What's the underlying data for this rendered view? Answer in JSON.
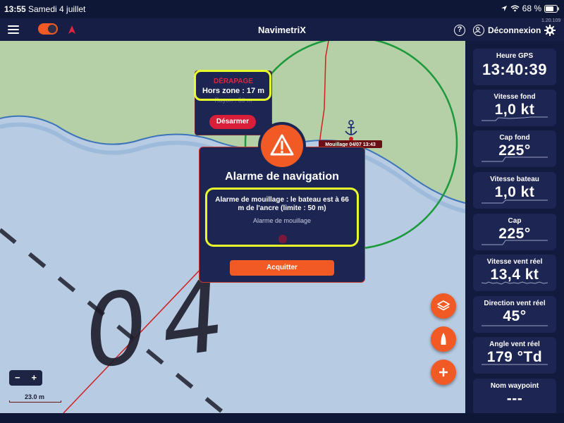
{
  "status_bar": {
    "time": "13:55",
    "date": "Samedi 4 juillet",
    "battery": "68 %"
  },
  "app": {
    "title": "NavimetriX",
    "logout_label": "Déconnexion",
    "version": "1.20.109",
    "help_label": "?"
  },
  "map": {
    "anchor_label": "Mouillage 04/07 13:43",
    "chart_number": "04",
    "zoom_out": "−",
    "zoom_in": "+",
    "scale_label": "23.0 m"
  },
  "drift_popup": {
    "title": "DÉRAPAGE",
    "line1": "Hors zone : 17 m",
    "line2": "Rayon : 50 m",
    "button": "Désarmer"
  },
  "alarm_modal": {
    "title": "Alarme de navigation",
    "message": "Alarme de mouillage : le bateau est à 66 m de l'ancre (limite : 50 m)",
    "subtitle": "Alarme de mouillage",
    "ack_button": "Acquitter"
  },
  "instruments": [
    {
      "label": "Heure GPS",
      "value": "13:40:39"
    },
    {
      "label": "Vitesse fond",
      "value": "1,0 kt"
    },
    {
      "label": "Cap fond",
      "value": "225°"
    },
    {
      "label": "Vitesse bateau",
      "value": "1,0 kt"
    },
    {
      "label": "Cap",
      "value": "225°"
    },
    {
      "label": "Vitesse vent réel",
      "value": "13,4 kt"
    },
    {
      "label": "Direction vent réel",
      "value": "45°"
    },
    {
      "label": "Angle vent réel",
      "value": "179 °Td"
    },
    {
      "label": "Nom waypoint",
      "value": "---"
    }
  ],
  "colors": {
    "accent": "#f15a24",
    "highlight": "#e8ff2b",
    "alert": "#d91e3a",
    "panel": "#1d2552"
  }
}
